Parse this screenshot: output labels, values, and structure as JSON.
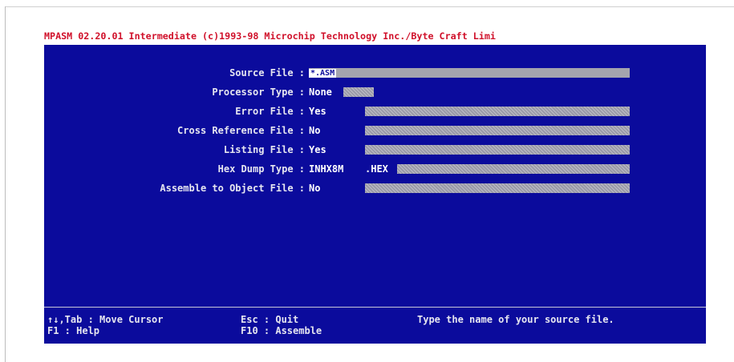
{
  "title": "MPASM 02.20.01 Intermediate (c)1993-98 Microchip Technology Inc./Byte Craft Limi",
  "fields": [
    {
      "label": "Source File :",
      "value": "*.ASM"
    },
    {
      "label": "Processor Type :",
      "value": "None"
    },
    {
      "label": "Error File :",
      "value": "Yes"
    },
    {
      "label": "Cross Reference File :",
      "value": "No"
    },
    {
      "label": "Listing File :",
      "value": "Yes"
    },
    {
      "label": "Hex Dump Type :",
      "value": "INHX8M",
      "extension": ".HEX"
    },
    {
      "label": "Assemble to Object File :",
      "value": "No"
    }
  ],
  "status": {
    "keys1": "↑↓,Tab : Move Cursor",
    "keys2": "F1     : Help",
    "esc": "Esc : Quit",
    "f10": "F10 : Assemble",
    "message": "Type the name of your source file."
  },
  "colors": {
    "background": "#0b0b9c",
    "title_text": "#d0102a",
    "field": "#9a9aa8"
  }
}
